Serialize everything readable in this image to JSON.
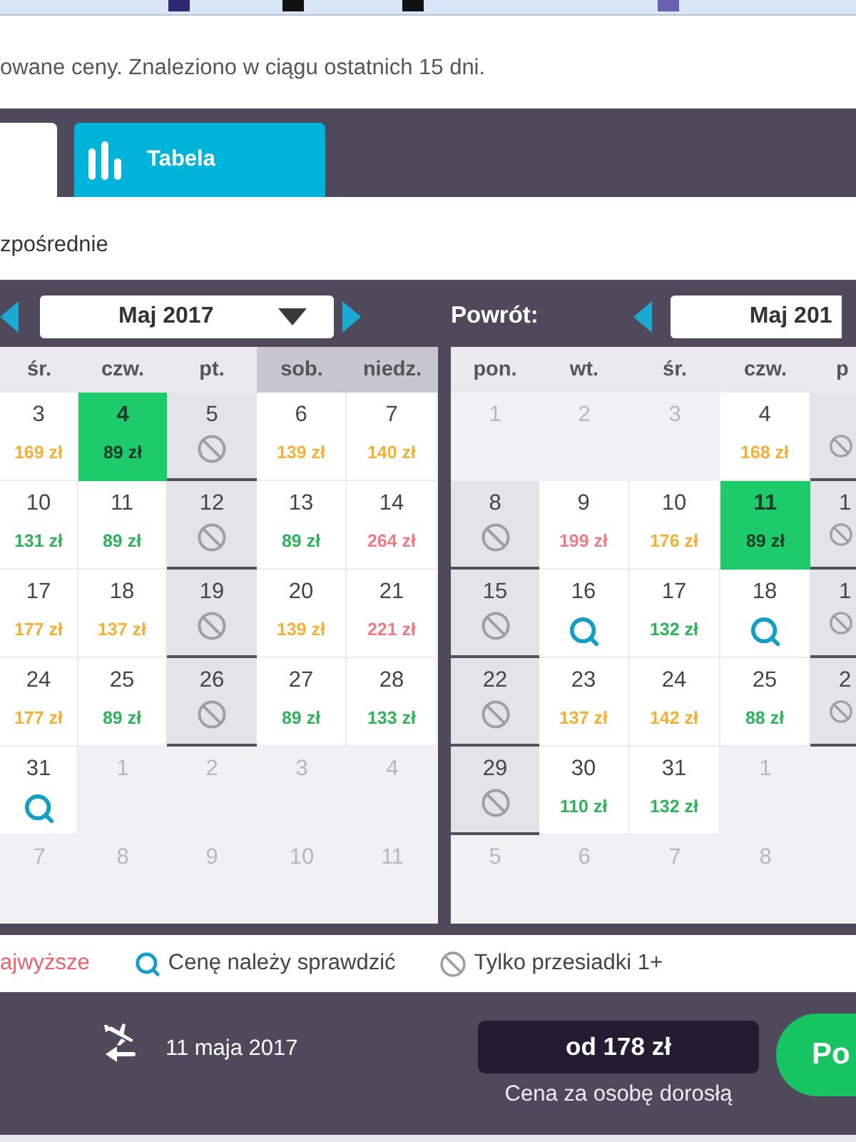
{
  "notice": "owane ceny. Znaleziono w ciągu ostatnich 15 dni.",
  "tabs": [
    {
      "selected": true
    },
    {
      "label": "Tabela",
      "selected": false
    }
  ],
  "filter_label": "zpośrednie",
  "departure_calendar": {
    "month": "Maj 2017",
    "weekdays": [
      {
        "label": "śr.",
        "weekend": false
      },
      {
        "label": "czw.",
        "weekend": false
      },
      {
        "label": "pt.",
        "weekend": false
      },
      {
        "label": "sob.",
        "weekend": true
      },
      {
        "label": "niedz.",
        "weekend": true
      }
    ],
    "weeks": [
      [
        {
          "day": "3",
          "kind": "price",
          "price": "169 zł",
          "color": "#f2b136",
          "selected": false
        },
        {
          "day": "4",
          "kind": "price",
          "price": "89 zł",
          "selected": true
        },
        {
          "day": "5",
          "kind": "transfer",
          "selected": false
        },
        {
          "day": "6",
          "kind": "price",
          "price": "139 zł",
          "color": "#f2b136",
          "selected": false
        },
        {
          "day": "7",
          "kind": "price",
          "price": "140 zł",
          "color": "#f2b136",
          "selected": false
        }
      ],
      [
        {
          "day": "10",
          "kind": "price",
          "price": "131 zł",
          "color": "#2fb35b",
          "selected": false
        },
        {
          "day": "11",
          "kind": "price",
          "price": "89 zł",
          "color": "#2fb35b",
          "selected": false
        },
        {
          "day": "12",
          "kind": "transfer",
          "selected": false
        },
        {
          "day": "13",
          "kind": "price",
          "price": "89 zł",
          "color": "#2fb35b",
          "selected": false
        },
        {
          "day": "14",
          "kind": "price",
          "price": "264 zł",
          "color": "#ec7d86",
          "selected": false
        }
      ],
      [
        {
          "day": "17",
          "kind": "price",
          "price": "177 zł",
          "color": "#f2b136",
          "selected": false
        },
        {
          "day": "18",
          "kind": "price",
          "price": "137 zł",
          "color": "#f2b136",
          "selected": false
        },
        {
          "day": "19",
          "kind": "transfer",
          "selected": false
        },
        {
          "day": "20",
          "kind": "price",
          "price": "139 zł",
          "color": "#f2b136",
          "selected": false
        },
        {
          "day": "21",
          "kind": "price",
          "price": "221 zł",
          "color": "#ec7d86",
          "selected": false
        }
      ],
      [
        {
          "day": "24",
          "kind": "price",
          "price": "177 zł",
          "color": "#f2b136",
          "selected": false
        },
        {
          "day": "25",
          "kind": "price",
          "price": "89 zł",
          "color": "#2fb35b",
          "selected": false
        },
        {
          "day": "26",
          "kind": "transfer",
          "selected": false
        },
        {
          "day": "27",
          "kind": "price",
          "price": "89 zł",
          "color": "#2fb35b",
          "selected": false
        },
        {
          "day": "28",
          "kind": "price",
          "price": "133 zł",
          "color": "#2fb35b",
          "selected": false
        }
      ],
      [
        {
          "day": "31",
          "kind": "check",
          "selected": false
        },
        {
          "day": "1",
          "kind": "outside",
          "selected": false
        },
        {
          "day": "2",
          "kind": "outside",
          "selected": false
        },
        {
          "day": "3",
          "kind": "outside",
          "selected": false
        },
        {
          "day": "4",
          "kind": "outside",
          "selected": false
        }
      ],
      [
        {
          "day": "7",
          "kind": "outside",
          "selected": false
        },
        {
          "day": "8",
          "kind": "outside",
          "selected": false
        },
        {
          "day": "9",
          "kind": "outside",
          "selected": false
        },
        {
          "day": "10",
          "kind": "outside",
          "selected": false
        },
        {
          "day": "11",
          "kind": "outside",
          "selected": false
        }
      ]
    ]
  },
  "return_calendar": {
    "title": "Powrót:",
    "month": "Maj 201",
    "weekdays": [
      {
        "label": "pon.",
        "weekend": false
      },
      {
        "label": "wt.",
        "weekend": false
      },
      {
        "label": "śr.",
        "weekend": false
      },
      {
        "label": "czw.",
        "weekend": false
      },
      {
        "label": "p",
        "weekend": false
      }
    ],
    "weeks": [
      [
        {
          "day": "1",
          "kind": "outside",
          "selected": false
        },
        {
          "day": "2",
          "kind": "outside",
          "selected": false
        },
        {
          "day": "3",
          "kind": "outside",
          "selected": false
        },
        {
          "day": "4",
          "kind": "price",
          "price": "168 zł",
          "color": "#f2b136",
          "selected": false
        },
        {
          "kind": "transfer",
          "selected": false
        }
      ],
      [
        {
          "day": "8",
          "kind": "transfer",
          "selected": false
        },
        {
          "day": "9",
          "kind": "price",
          "price": "199 zł",
          "color": "#ec7d86",
          "selected": false
        },
        {
          "day": "10",
          "kind": "price",
          "price": "176 zł",
          "color": "#f2b136",
          "selected": false
        },
        {
          "day": "11",
          "kind": "price",
          "price": "89 zł",
          "selected": true
        },
        {
          "day": "1",
          "kind": "transfer",
          "selected": false
        }
      ],
      [
        {
          "day": "15",
          "kind": "transfer",
          "selected": false
        },
        {
          "day": "16",
          "kind": "check",
          "selected": false
        },
        {
          "day": "17",
          "kind": "price",
          "price": "132 zł",
          "color": "#2fb35b",
          "selected": false
        },
        {
          "day": "18",
          "kind": "check",
          "selected": false
        },
        {
          "day": "1",
          "kind": "transfer",
          "selected": false
        }
      ],
      [
        {
          "day": "22",
          "kind": "transfer",
          "selected": false
        },
        {
          "day": "23",
          "kind": "price",
          "price": "137 zł",
          "color": "#f2b136",
          "selected": false
        },
        {
          "day": "24",
          "kind": "price",
          "price": "142 zł",
          "color": "#f2b136",
          "selected": false
        },
        {
          "day": "25",
          "kind": "price",
          "price": "88 zł",
          "color": "#2fb35b",
          "selected": false
        },
        {
          "day": "2",
          "kind": "transfer",
          "selected": false
        }
      ],
      [
        {
          "day": "29",
          "kind": "transfer",
          "selected": false
        },
        {
          "day": "30",
          "kind": "price",
          "price": "110 zł",
          "color": "#2fb35b",
          "selected": false
        },
        {
          "day": "31",
          "kind": "price",
          "price": "132 zł",
          "color": "#2fb35b",
          "selected": false
        },
        {
          "day": "1",
          "kind": "outside",
          "selected": false
        },
        {
          "kind": "outside",
          "selected": false
        }
      ],
      [
        {
          "day": "5",
          "kind": "outside",
          "selected": false
        },
        {
          "day": "6",
          "kind": "outside",
          "selected": false
        },
        {
          "day": "7",
          "kind": "outside",
          "selected": false
        },
        {
          "day": "8",
          "kind": "outside",
          "selected": false
        },
        {
          "kind": "outside",
          "selected": false
        }
      ]
    ]
  },
  "legend": [
    {
      "kind": "high",
      "label": "ajwyższe"
    },
    {
      "kind": "check",
      "label": "Cenę należy sprawdzić"
    },
    {
      "kind": "transfer",
      "label": "Tylko przesiadki 1+"
    }
  ],
  "footer": {
    "date": "11 maja 2017",
    "price": "od 178 zł",
    "price_note": "Cena za osobę dorosłą",
    "button": "Po"
  }
}
